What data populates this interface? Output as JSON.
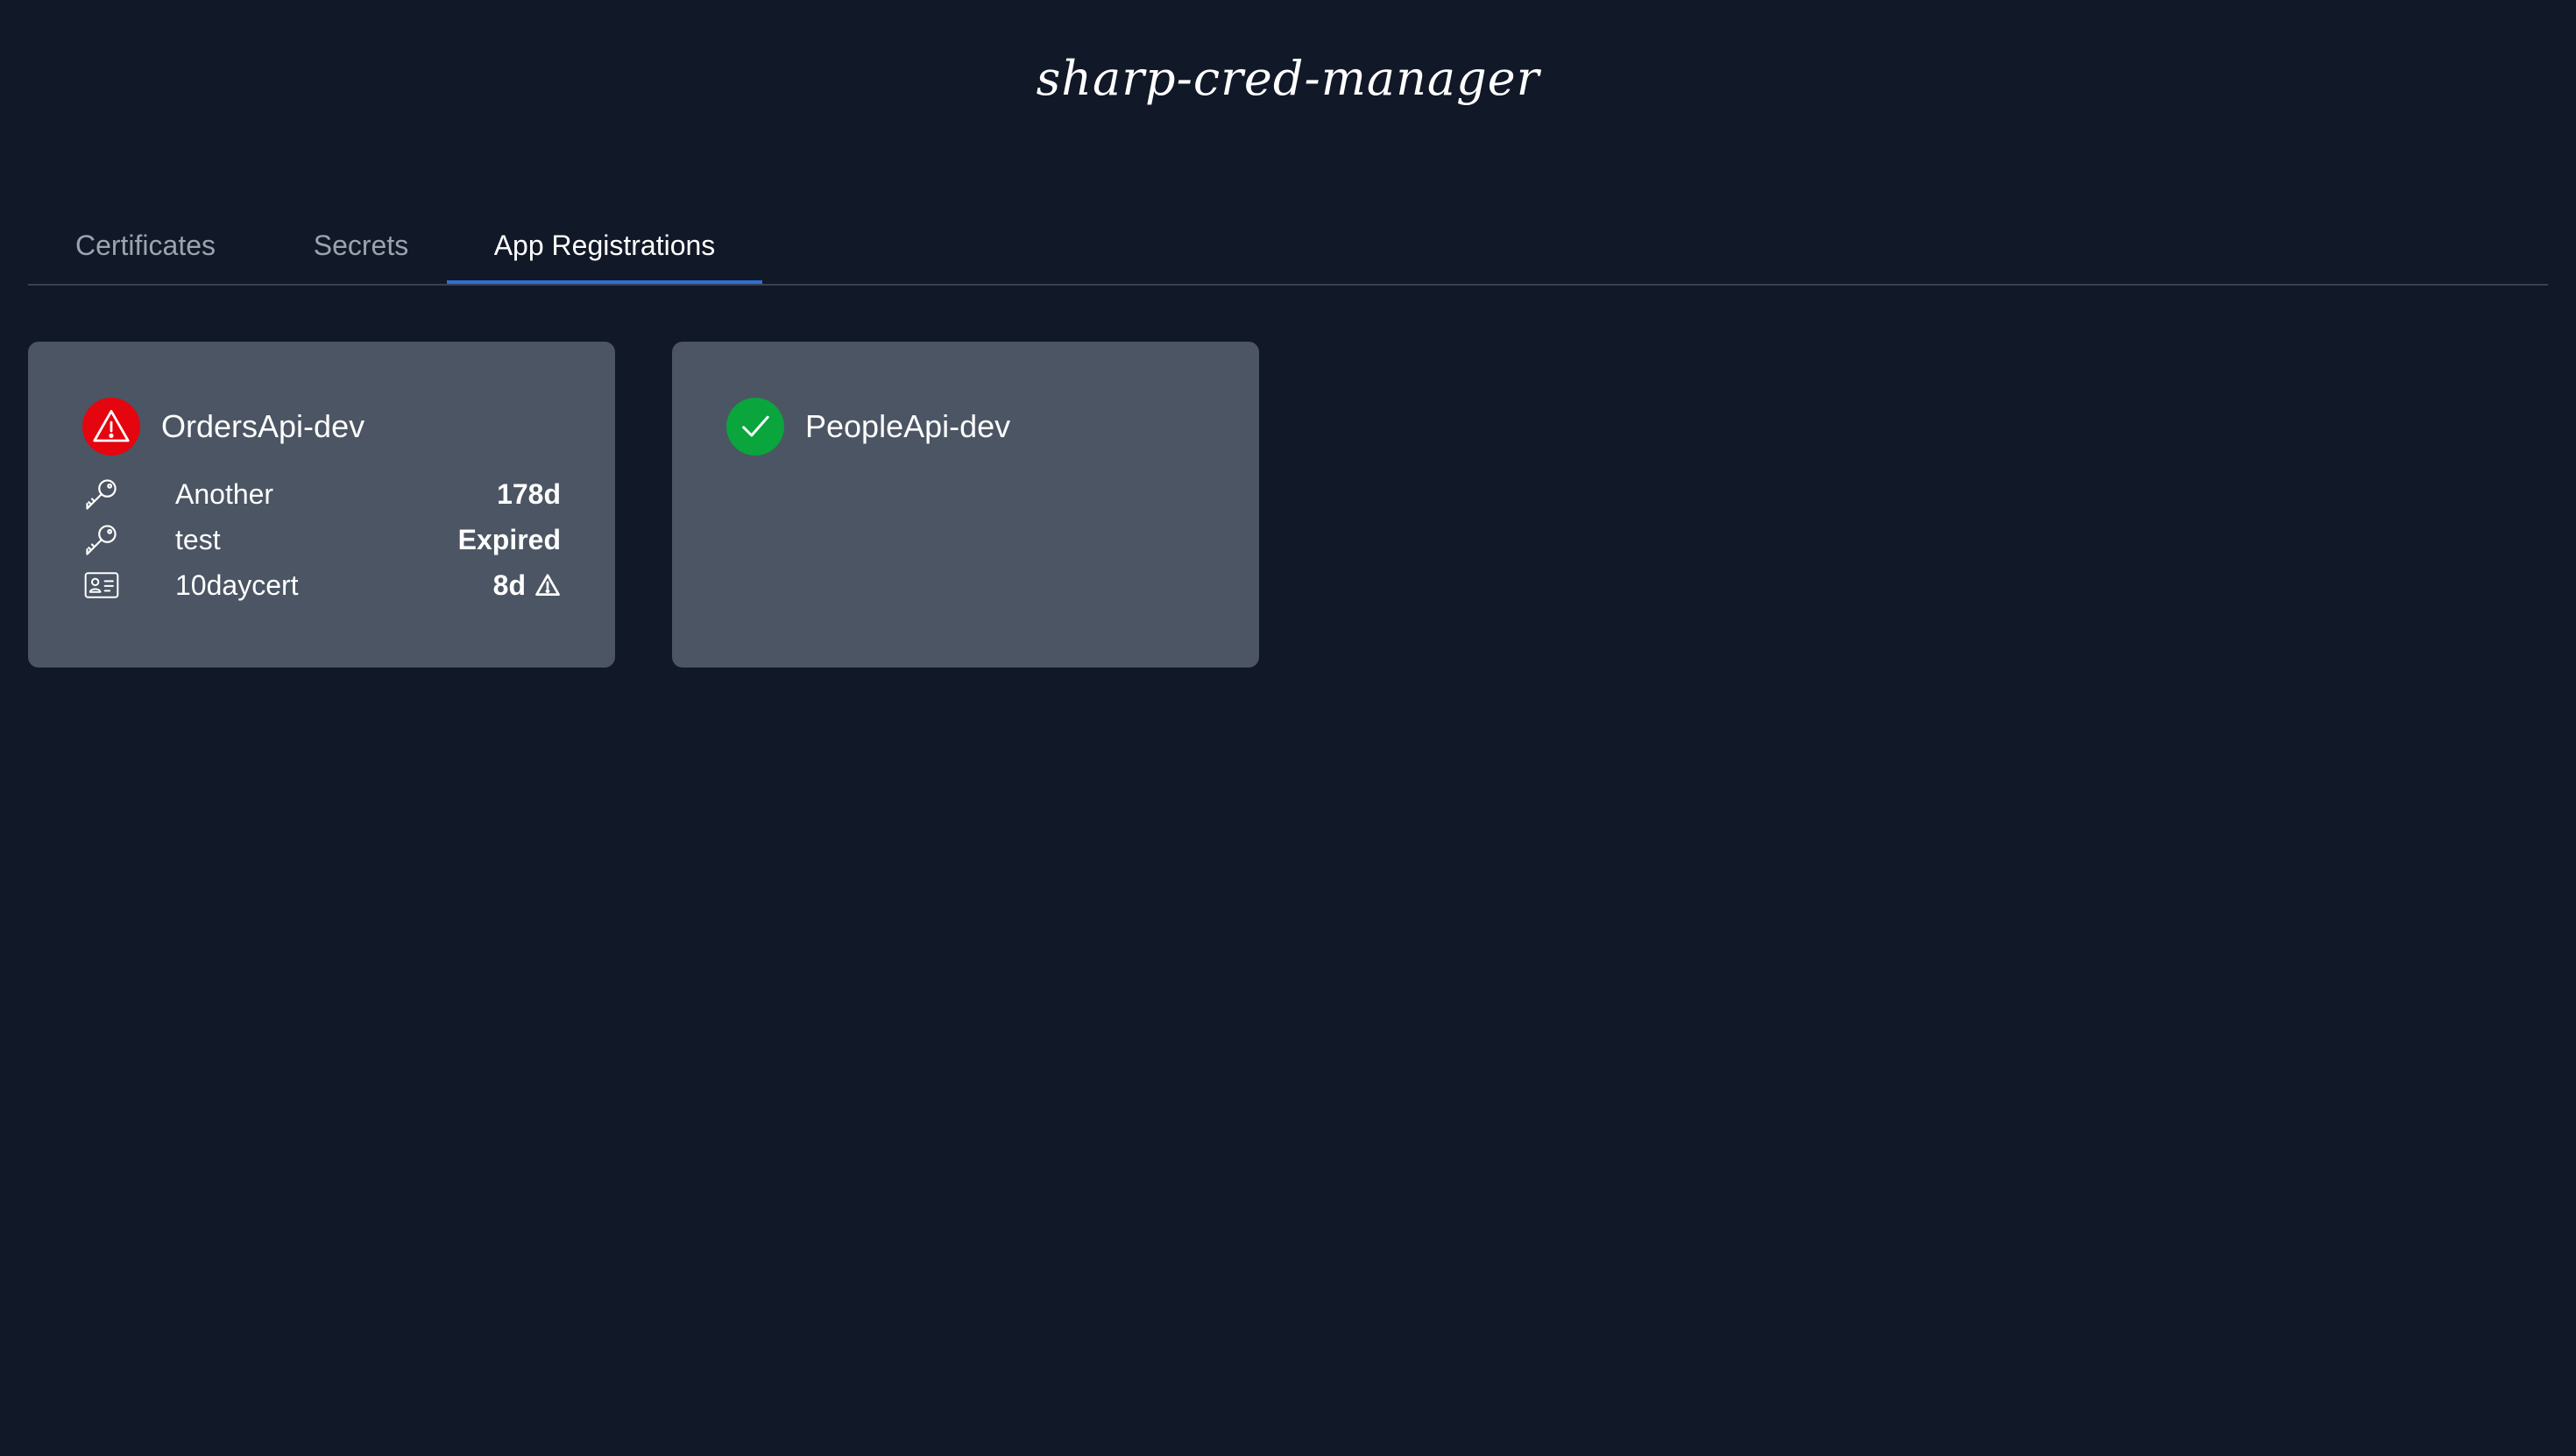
{
  "app": {
    "title": "sharp-cred-manager"
  },
  "tabs": [
    {
      "label": "Certificates",
      "active": false
    },
    {
      "label": "Secrets",
      "active": false
    },
    {
      "label": "App Registrations",
      "active": true
    }
  ],
  "colors": {
    "background": "#111827",
    "card": "#4b5563",
    "accent": "#2f6fd6",
    "status_bad": "#e4050f",
    "status_good": "#0aa53c"
  },
  "cards": [
    {
      "name": "OrdersApi-dev",
      "status": "warning",
      "status_icon": "warning-triangle-icon",
      "items": [
        {
          "icon": "key-icon",
          "label": "Another",
          "value": "178d",
          "warning": false
        },
        {
          "icon": "key-icon",
          "label": "test",
          "value": "Expired",
          "warning": false
        },
        {
          "icon": "certificate-card-icon",
          "label": "10daycert",
          "value": "8d",
          "warning": true
        }
      ]
    },
    {
      "name": "PeopleApi-dev",
      "status": "ok",
      "status_icon": "checkmark-icon",
      "items": []
    }
  ]
}
